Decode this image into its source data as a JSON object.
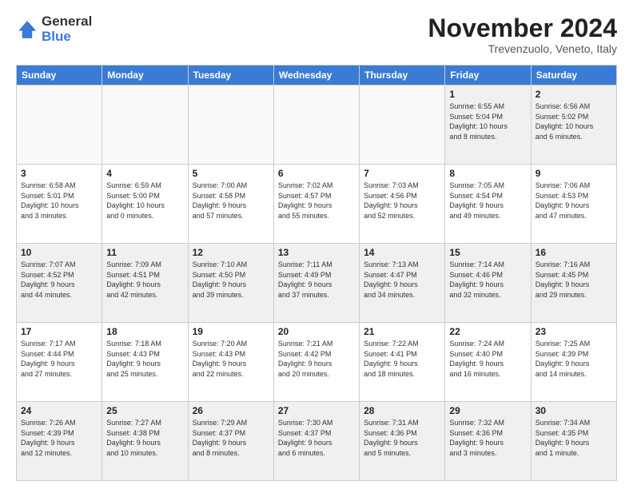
{
  "logo": {
    "general": "General",
    "blue": "Blue"
  },
  "header": {
    "month": "November 2024",
    "location": "Trevenzuolo, Veneto, Italy"
  },
  "days_of_week": [
    "Sunday",
    "Monday",
    "Tuesday",
    "Wednesday",
    "Thursday",
    "Friday",
    "Saturday"
  ],
  "weeks": [
    [
      {
        "day": "",
        "info": ""
      },
      {
        "day": "",
        "info": ""
      },
      {
        "day": "",
        "info": ""
      },
      {
        "day": "",
        "info": ""
      },
      {
        "day": "",
        "info": ""
      },
      {
        "day": "1",
        "info": "Sunrise: 6:55 AM\nSunset: 5:04 PM\nDaylight: 10 hours\nand 8 minutes."
      },
      {
        "day": "2",
        "info": "Sunrise: 6:56 AM\nSunset: 5:02 PM\nDaylight: 10 hours\nand 6 minutes."
      }
    ],
    [
      {
        "day": "3",
        "info": "Sunrise: 6:58 AM\nSunset: 5:01 PM\nDaylight: 10 hours\nand 3 minutes."
      },
      {
        "day": "4",
        "info": "Sunrise: 6:59 AM\nSunset: 5:00 PM\nDaylight: 10 hours\nand 0 minutes."
      },
      {
        "day": "5",
        "info": "Sunrise: 7:00 AM\nSunset: 4:58 PM\nDaylight: 9 hours\nand 57 minutes."
      },
      {
        "day": "6",
        "info": "Sunrise: 7:02 AM\nSunset: 4:57 PM\nDaylight: 9 hours\nand 55 minutes."
      },
      {
        "day": "7",
        "info": "Sunrise: 7:03 AM\nSunset: 4:56 PM\nDaylight: 9 hours\nand 52 minutes."
      },
      {
        "day": "8",
        "info": "Sunrise: 7:05 AM\nSunset: 4:54 PM\nDaylight: 9 hours\nand 49 minutes."
      },
      {
        "day": "9",
        "info": "Sunrise: 7:06 AM\nSunset: 4:53 PM\nDaylight: 9 hours\nand 47 minutes."
      }
    ],
    [
      {
        "day": "10",
        "info": "Sunrise: 7:07 AM\nSunset: 4:52 PM\nDaylight: 9 hours\nand 44 minutes."
      },
      {
        "day": "11",
        "info": "Sunrise: 7:09 AM\nSunset: 4:51 PM\nDaylight: 9 hours\nand 42 minutes."
      },
      {
        "day": "12",
        "info": "Sunrise: 7:10 AM\nSunset: 4:50 PM\nDaylight: 9 hours\nand 39 minutes."
      },
      {
        "day": "13",
        "info": "Sunrise: 7:11 AM\nSunset: 4:49 PM\nDaylight: 9 hours\nand 37 minutes."
      },
      {
        "day": "14",
        "info": "Sunrise: 7:13 AM\nSunset: 4:47 PM\nDaylight: 9 hours\nand 34 minutes."
      },
      {
        "day": "15",
        "info": "Sunrise: 7:14 AM\nSunset: 4:46 PM\nDaylight: 9 hours\nand 32 minutes."
      },
      {
        "day": "16",
        "info": "Sunrise: 7:16 AM\nSunset: 4:45 PM\nDaylight: 9 hours\nand 29 minutes."
      }
    ],
    [
      {
        "day": "17",
        "info": "Sunrise: 7:17 AM\nSunset: 4:44 PM\nDaylight: 9 hours\nand 27 minutes."
      },
      {
        "day": "18",
        "info": "Sunrise: 7:18 AM\nSunset: 4:43 PM\nDaylight: 9 hours\nand 25 minutes."
      },
      {
        "day": "19",
        "info": "Sunrise: 7:20 AM\nSunset: 4:43 PM\nDaylight: 9 hours\nand 22 minutes."
      },
      {
        "day": "20",
        "info": "Sunrise: 7:21 AM\nSunset: 4:42 PM\nDaylight: 9 hours\nand 20 minutes."
      },
      {
        "day": "21",
        "info": "Sunrise: 7:22 AM\nSunset: 4:41 PM\nDaylight: 9 hours\nand 18 minutes."
      },
      {
        "day": "22",
        "info": "Sunrise: 7:24 AM\nSunset: 4:40 PM\nDaylight: 9 hours\nand 16 minutes."
      },
      {
        "day": "23",
        "info": "Sunrise: 7:25 AM\nSunset: 4:39 PM\nDaylight: 9 hours\nand 14 minutes."
      }
    ],
    [
      {
        "day": "24",
        "info": "Sunrise: 7:26 AM\nSunset: 4:39 PM\nDaylight: 9 hours\nand 12 minutes."
      },
      {
        "day": "25",
        "info": "Sunrise: 7:27 AM\nSunset: 4:38 PM\nDaylight: 9 hours\nand 10 minutes."
      },
      {
        "day": "26",
        "info": "Sunrise: 7:29 AM\nSunset: 4:37 PM\nDaylight: 9 hours\nand 8 minutes."
      },
      {
        "day": "27",
        "info": "Sunrise: 7:30 AM\nSunset: 4:37 PM\nDaylight: 9 hours\nand 6 minutes."
      },
      {
        "day": "28",
        "info": "Sunrise: 7:31 AM\nSunset: 4:36 PM\nDaylight: 9 hours\nand 5 minutes."
      },
      {
        "day": "29",
        "info": "Sunrise: 7:32 AM\nSunset: 4:36 PM\nDaylight: 9 hours\nand 3 minutes."
      },
      {
        "day": "30",
        "info": "Sunrise: 7:34 AM\nSunset: 4:35 PM\nDaylight: 9 hours\nand 1 minute."
      }
    ]
  ]
}
